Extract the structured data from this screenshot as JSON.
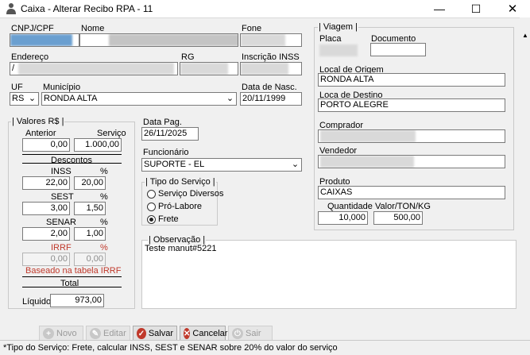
{
  "window": {
    "title": "Caixa - Alterar Recibo RPA - 11"
  },
  "labels": {
    "cnpj": "CNPJ/CPF",
    "nome": "Nome",
    "fone": "Fone",
    "endereco": "Endereço",
    "rg": "RG",
    "inscricao": "Inscrição INSS",
    "uf": "UF",
    "municipio": "Município",
    "data_nasc": "Data de Nasc.",
    "data_pag": "Data Pag.",
    "funcionario": "Funcionário",
    "placa": "Placa",
    "documento": "Documento",
    "local_origem": "Local de Origem",
    "local_destino": "Loca de Destino",
    "comprador": "Comprador",
    "vendedor": "Vendedor",
    "produto": "Produto",
    "quantidade": "Quantidade",
    "valor_ton": "Valor/TON/KG"
  },
  "form": {
    "uf": "RS",
    "municipio": "RONDA ALTA",
    "data_nasc": "20/11/1999",
    "data_pag": "26/11/2025",
    "funcionario": "SUPORTE - EL",
    "local_origem": "RONDA ALTA",
    "local_destino": "PORTO ALEGRE",
    "produto": "CAIXAS",
    "quantidade": "10,000",
    "valor_ton": "500,00",
    "endereco_start": "/"
  },
  "valores": {
    "title": "Valores R$",
    "anterior_label": "Anterior",
    "servico_label": "Serviço",
    "anterior": "0,00",
    "servico": "1.000,00",
    "descontos_label": "Descontos",
    "inss_label": "INSS",
    "inss_pct_label": "%",
    "inss": "22,00",
    "inss_pct": "20,00",
    "sest_label": "SEST",
    "sest_pct_label": "%",
    "sest": "3,00",
    "sest_pct": "1,50",
    "senar_label": "SENAR",
    "senar_pct_label": "%",
    "senar": "2,00",
    "senar_pct": "1,00",
    "irrf_label": "IRRF",
    "irrf_pct_label": "%",
    "irrf": "0,00",
    "irrf_pct": "0,00",
    "irrf_note": "Baseado na tabela IRRF",
    "total_label": "Total",
    "liquido_label": "Líquido",
    "liquido": "973,00"
  },
  "tipo_servico": {
    "title": "Tipo do Serviço",
    "options": [
      "Serviço Diversos",
      "Pró-Labore",
      "Frete"
    ],
    "selected": "Frete"
  },
  "viagem": {
    "title": "Viagem"
  },
  "observacao": {
    "title": "Observação",
    "text": "Teste manut#5221"
  },
  "buttons": {
    "novo": "Novo",
    "editar": "Editar",
    "salvar": "Salvar",
    "cancelar": "Cancelar",
    "sair": "Sair"
  },
  "status": "*Tipo do Serviço: Frete, calcular INSS, SEST e SENAR sobre 20% do valor do serviço",
  "colors": {
    "accent_red": "#c0392b",
    "salvar_icon": "#c0392b",
    "cancelar_icon": "#c0392b"
  }
}
